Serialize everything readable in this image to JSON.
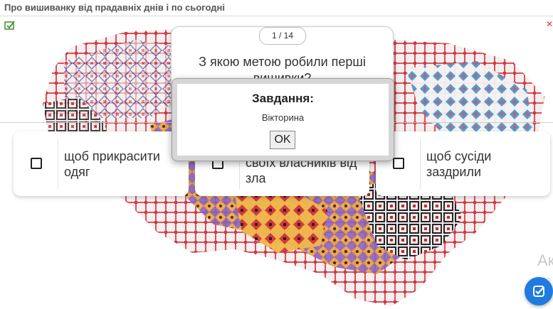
{
  "app": {
    "title": "Про вишиванку від прадавніх днів і по сьогодні"
  },
  "quiz": {
    "counter": "1 / 14",
    "question": "З якою метою робили перші вишивки?",
    "answers": [
      {
        "label": "щоб прикрасити одяг"
      },
      {
        "label": "своїх власників від зла"
      },
      {
        "label": "щоб сусіди заздрили"
      }
    ]
  },
  "dialog": {
    "title": "Завдання:",
    "text": "Вікторина",
    "ok_label": "OK"
  },
  "watermark": {
    "text": "Ак",
    "small": "ято\nпер"
  },
  "icons": {
    "help": "help-icon",
    "close": "close-icon",
    "fab": "check-edit-icon"
  },
  "colors": {
    "accent": "#1e7be0",
    "embroidery_red": "#d8323a",
    "embroidery_black": "#222222"
  }
}
